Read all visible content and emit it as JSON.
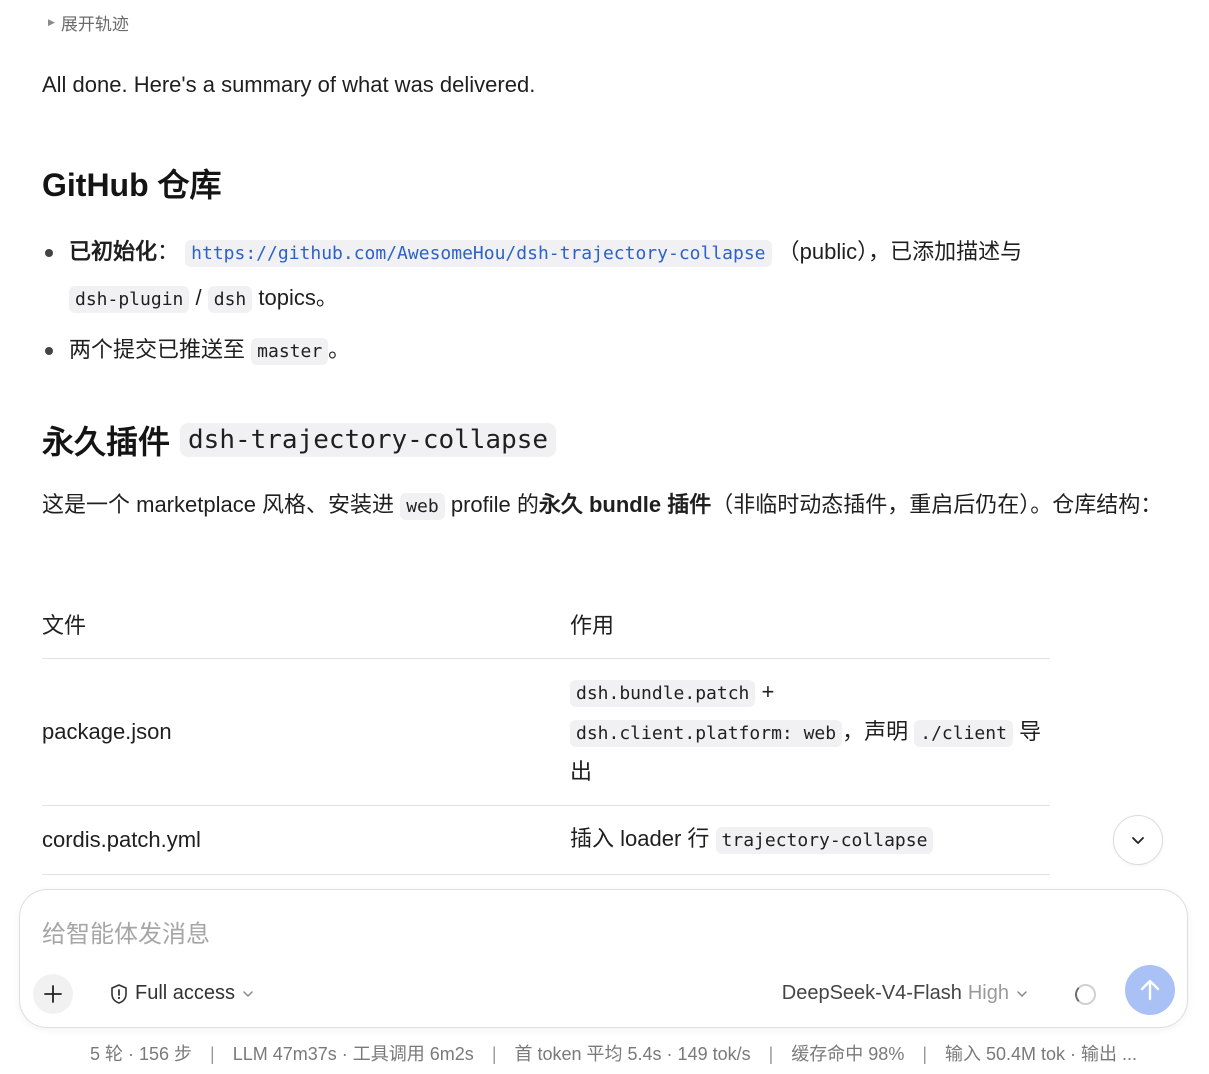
{
  "trajectory_toggle": "展开轨迹",
  "summary": "All done. Here's a summary of what was delivered.",
  "section1": {
    "title": "GitHub 仓库",
    "bullet1": {
      "label": "已初始化",
      "colon": "：",
      "url": "https://github.com/AwesomeHou/dsh-trajectory-collapse",
      "after_url": "（public），已添加描述与",
      "topic1": "dsh-plugin",
      "slash": "/",
      "topic2": "dsh",
      "tail": "topics。"
    },
    "bullet2": {
      "text": "两个提交已推送至",
      "branch": "master",
      "tail": "。"
    }
  },
  "section2": {
    "title": "永久插件",
    "title_code": "dsh-trajectory-collapse",
    "desc": {
      "p1": "这是一个 marketplace 风格、安装进",
      "web_code": "web",
      "p2": "profile 的",
      "bold": "永久 bundle 插件",
      "p3": "（非临时动态插件，重启后仍在）。仓库结构："
    },
    "table": {
      "headers": [
        "文件",
        "作用"
      ],
      "row1": {
        "file": "package.json",
        "code1": "dsh.bundle.patch",
        "plus": "+",
        "code2": "dsh.client.platform: web",
        "mid": "，声明",
        "code3": "./client",
        "tail": "导出"
      },
      "row2": {
        "file": "cordis.patch.yml",
        "text": "插入 loader 行",
        "code": "trajectory-collapse"
      }
    }
  },
  "composer": {
    "placeholder": "给智能体发消息",
    "access_label": "Full access",
    "model_name": "DeepSeek-V4-Flash",
    "model_level": "High"
  },
  "status": {
    "rounds": "5 轮 · 156 步",
    "llm": "LLM 47m37s · 工具调用 6m2s",
    "first_token": "首 token 平均 5.4s · 149 tok/s",
    "cache": "缓存命中 98%",
    "io": "输入 50.4M tok · 输出 ..."
  }
}
